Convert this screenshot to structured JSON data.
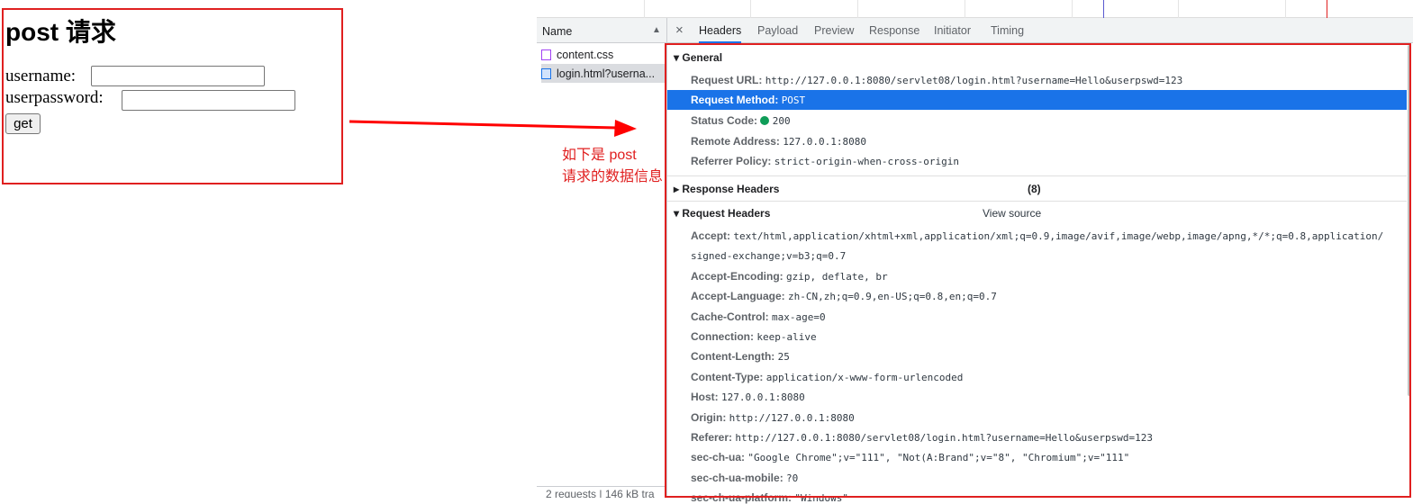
{
  "page": {
    "title": "post 请求",
    "username_label": "username:",
    "password_label": "userpassword:",
    "username_value": "",
    "password_value": "",
    "button": "get"
  },
  "annotation": {
    "line1": "如下是 post",
    "line2": "请求的数据信息"
  },
  "devtools": {
    "name_header": "Name",
    "sort_icon": "▲",
    "files": [
      "content.css",
      "login.html?userna..."
    ],
    "status_bar": "2 requests  |  146 kB tra",
    "close": "×",
    "tabs": [
      "Headers",
      "Payload",
      "Preview",
      "Response",
      "Initiator",
      "Timing"
    ],
    "general": {
      "title": "General",
      "rows": [
        {
          "k": "Request URL:",
          "v": "http://127.0.0.1:8080/servlet08/login.html?username=Hello&userpswd=123"
        },
        {
          "k": "Request Method:",
          "v": "POST"
        },
        {
          "k": "Status Code:",
          "v": "200"
        },
        {
          "k": "Remote Address:",
          "v": "127.0.0.1:8080"
        },
        {
          "k": "Referrer Policy:",
          "v": "strict-origin-when-cross-origin"
        }
      ]
    },
    "response_headers": {
      "title": "Response Headers",
      "count": "(8)"
    },
    "request_headers": {
      "title": "Request Headers",
      "view_source": "View source",
      "rows": [
        {
          "k": "Accept:",
          "v": "text/html,application/xhtml+xml,application/xml;q=0.9,image/avif,image/webp,image/apng,*/*;q=0.8,application/"
        },
        {
          "k": "",
          "v": "signed-exchange;v=b3;q=0.7"
        },
        {
          "k": "Accept-Encoding:",
          "v": "gzip, deflate, br"
        },
        {
          "k": "Accept-Language:",
          "v": "zh-CN,zh;q=0.9,en-US;q=0.8,en;q=0.7"
        },
        {
          "k": "Cache-Control:",
          "v": "max-age=0"
        },
        {
          "k": "Connection:",
          "v": "keep-alive"
        },
        {
          "k": "Content-Length:",
          "v": "25"
        },
        {
          "k": "Content-Type:",
          "v": "application/x-www-form-urlencoded"
        },
        {
          "k": "Host:",
          "v": "127.0.0.1:8080"
        },
        {
          "k": "Origin:",
          "v": "http://127.0.0.1:8080"
        },
        {
          "k": "Referer:",
          "v": "http://127.0.0.1:8080/servlet08/login.html?username=Hello&userpswd=123"
        },
        {
          "k": "sec-ch-ua:",
          "v": "\"Google Chrome\";v=\"111\", \"Not(A:Brand\";v=\"8\", \"Chromium\";v=\"111\""
        },
        {
          "k": "sec-ch-ua-mobile:",
          "v": "?0"
        },
        {
          "k": "sec-ch-ua-platform:",
          "v": "\"Windows\""
        }
      ]
    }
  },
  "colors": {
    "highlight": "#1a73e8",
    "annotation": "#e02020",
    "status_ok": "#0f9d58"
  }
}
